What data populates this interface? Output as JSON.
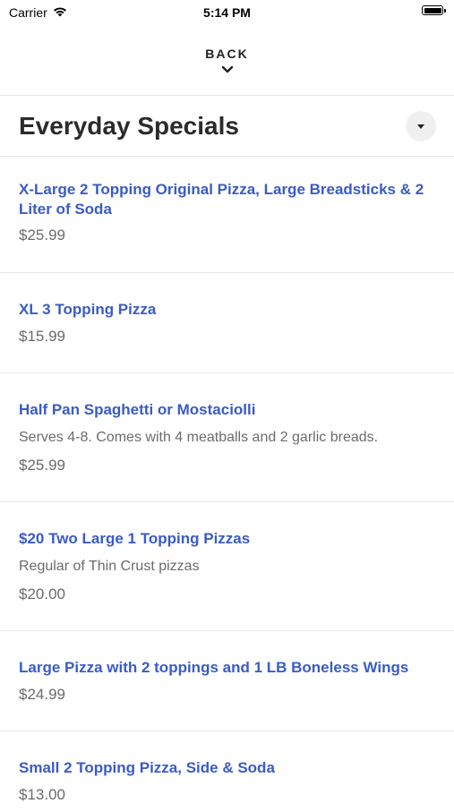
{
  "status_bar": {
    "carrier": "Carrier",
    "time": "5:14 PM"
  },
  "nav": {
    "back_label": "BACK"
  },
  "section": {
    "title": "Everyday Specials"
  },
  "items": [
    {
      "name": "X-Large 2 Topping Original Pizza, Large Breadsticks & 2 Liter of Soda",
      "description": "",
      "price": "$25.99"
    },
    {
      "name": "XL 3 Topping Pizza",
      "description": "",
      "price": "$15.99"
    },
    {
      "name": "Half Pan Spaghetti or Mostaciolli",
      "description": "Serves 4-8. Comes with 4 meatballs and 2 garlic breads.",
      "price": "$25.99"
    },
    {
      "name": "$20 Two Large 1 Topping Pizzas",
      "description": "Regular of Thin Crust pizzas",
      "price": "$20.00"
    },
    {
      "name": "Large Pizza with 2 toppings and 1 LB Boneless Wings",
      "description": "",
      "price": "$24.99"
    },
    {
      "name": "Small 2 Topping Pizza, Side & Soda",
      "description": "",
      "price": "$13.00"
    }
  ],
  "colors": {
    "item_name": "#3a5bc7",
    "text_muted": "#6b6b6b",
    "divider": "#e6e6e6"
  }
}
